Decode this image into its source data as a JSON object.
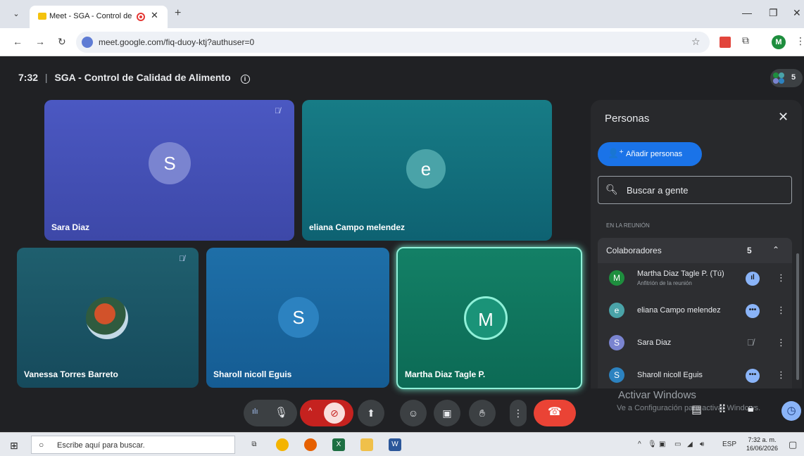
{
  "browser": {
    "tab_title": "Meet - SGA - Control de Ca",
    "new_tab": "+",
    "url": "meet.google.com/fiq-duoy-ktj?authuser=0",
    "profile_initial": "M"
  },
  "meeting": {
    "time": "7:32",
    "separator": "|",
    "title": "SGA - Control de Calidad de Alimento",
    "participant_count": "5"
  },
  "tiles": [
    {
      "name": "Sara Diaz",
      "initial": "S",
      "muted": true,
      "color": "#4b58c2",
      "avatar_color": "#7a84d0"
    },
    {
      "name": "eliana Campo melendez",
      "initial": "e",
      "muted": false,
      "color": "#177c86",
      "avatar_color": "#4aa3a8"
    },
    {
      "name": "Vanessa Torres Barreto",
      "initial": "",
      "muted": true,
      "color": "#1f5f6e",
      "avatar_color": "#3b6f8a"
    },
    {
      "name": "Sharoll nicoll Eguis",
      "initial": "S",
      "muted": false,
      "color": "#1e6fa8",
      "avatar_color": "#2c82c0"
    },
    {
      "name": "Martha Diaz Tagle P.",
      "initial": "M",
      "muted": false,
      "color": "#138066",
      "avatar_color": "#1a9378"
    }
  ],
  "panel": {
    "title": "Personas",
    "add_label": "Añadir personas",
    "search_placeholder": "Buscar a gente",
    "section_label": "EN LA REUNIÓN",
    "group_label": "Colaboradores",
    "group_count": "5",
    "people": [
      {
        "name": "Martha Diaz Tagle P. (Tú)",
        "subtitle": "Anfitrión de la reunión",
        "initial": "M",
        "color": "#1e8e3e",
        "status": "speaking"
      },
      {
        "name": "eliana Campo melendez",
        "subtitle": "",
        "initial": "e",
        "color": "#4aa3a8",
        "status": "more"
      },
      {
        "name": "Sara Diaz",
        "subtitle": "",
        "initial": "S",
        "color": "#7a84d0",
        "status": "muted"
      },
      {
        "name": "Sharoll nicoll Eguis",
        "subtitle": "",
        "initial": "S",
        "color": "#2c82c0",
        "status": "more"
      }
    ]
  },
  "watermark": {
    "line1": "Activar Windows",
    "line2": "Ve a Configuración para activar Windows."
  },
  "taskbar": {
    "search_text": "Escribe aquí para buscar.",
    "lang": "ESP",
    "time": "7:32 a. m.",
    "date": "16/06/2026"
  },
  "colors": {
    "accent": "#1a73e8",
    "end_call": "#ea4335",
    "camera_off": "#c5221f",
    "active_speaker": "#8ff0d8"
  }
}
